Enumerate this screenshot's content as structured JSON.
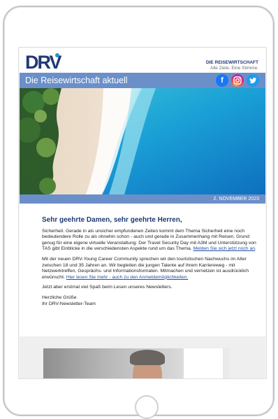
{
  "newsletter": {
    "brand_name": "DRV",
    "brand_title": "DIE REISEWIRTSCHAFT",
    "brand_tagline": "Alle Ziele. Eine Stimme.",
    "title": "Die Reisewirtschaft aktuell",
    "social": [
      {
        "name": "facebook",
        "glyph": "f",
        "color": "#1877f2"
      },
      {
        "name": "instagram",
        "glyph": "◎",
        "color": "#d42b82"
      },
      {
        "name": "twitter",
        "glyph": "🐦",
        "color": "#1d9bf0"
      }
    ],
    "date": "2. NOVEMBER 2023",
    "greeting": "Sehr geehrte Damen, sehr geehrte Herren,",
    "para1": "Sicherheit. Gerade in als unsicher empfundenen Zeiten kommt dem Thema Sicherheit eine noch bedeutendere Rolle zu als ohnehin schon - auch und gerade in Zusammenhang mit Reisen. Grund genug für eine eigene virtuelle Veranstaltung: Der Travel Security Day mit A3M und Unterstützung von TAS gibt Einblicke in die verschiedensten Aspekte rund um das Thema.",
    "para1_link": "Melden Sie sich jetzt noch an",
    "para2": "Mit der neuen DRV-Young Career Community sprechen wir den touristischen Nachwuchs im Alter zwischen 18 und 35 Jahren an. Wir begleiten die jungen Talente auf ihrem Karriereweg - mit Netzwerktreffen, Gesprächs- und Informationsformaten. Mitmachen und vernetzen ist ausdrücklich erwünscht.",
    "para2_link": "Hier lesen Sie mehr - auch zu den Anmeldemöglichkeiten.",
    "para3": "Jetzt aber erstmal viel Spaß beim Lesen unseres Newsletters.",
    "closing": "Herzliche Grüße",
    "signature": "Ihr DRV-Newsletter-Team"
  },
  "colors": {
    "brand_blue": "#1f3a74",
    "bar_blue": "#6a8fc9",
    "link": "#1f4fa0"
  }
}
